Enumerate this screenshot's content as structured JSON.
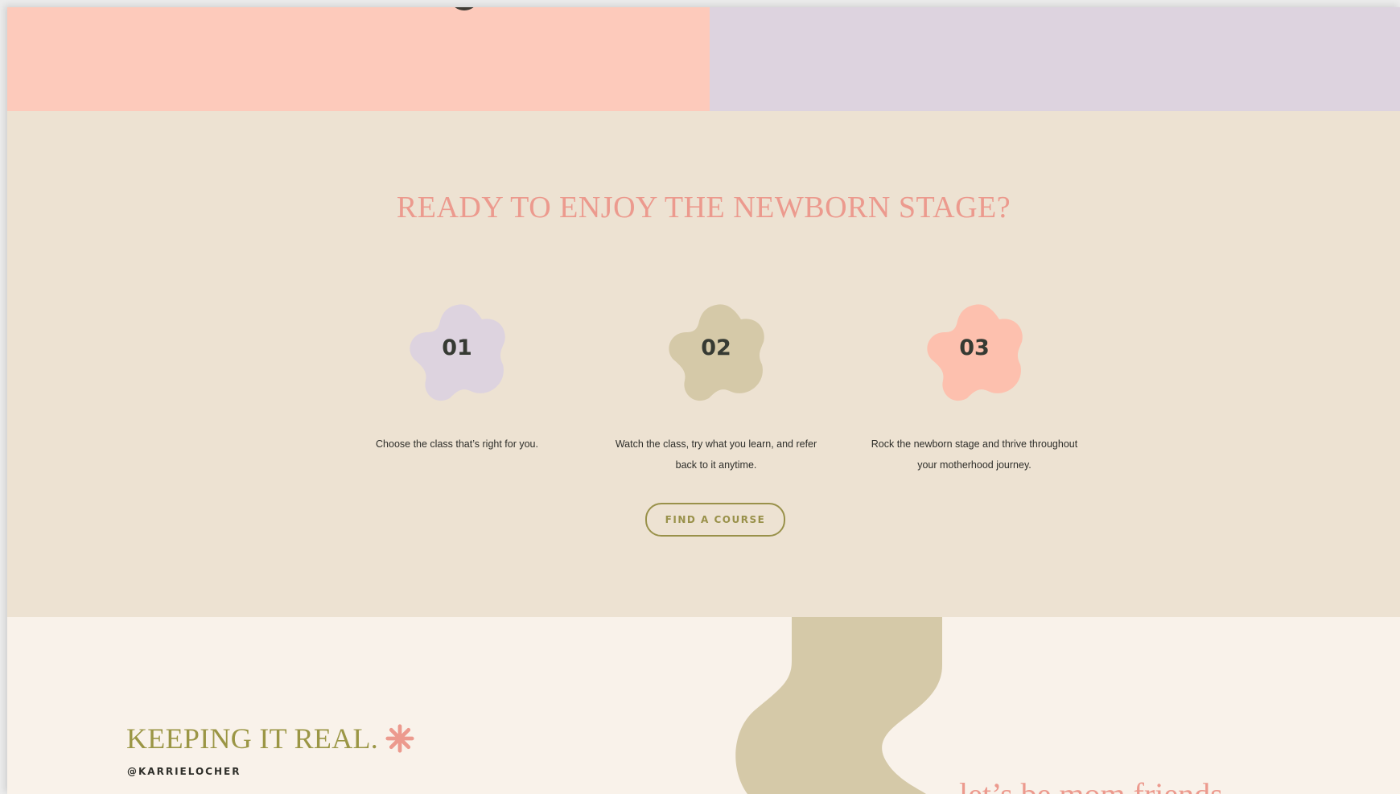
{
  "colors": {
    "peach": "#fdcabb",
    "lavender": "#ddd3df",
    "sand": "#ede2d2",
    "cream": "#f9f2ea",
    "olive": "#99914a",
    "khaki": "#d5c9a8",
    "coral_text": "#ec9a8e",
    "dark_text": "#363a33"
  },
  "steps_section": {
    "headline": "READY TO ENJOY THE NEWBORN STAGE?",
    "steps": [
      {
        "number": "01",
        "text": "Choose the class that’s right for you.",
        "blob_color": "#ddd3df"
      },
      {
        "number": "02",
        "text": "Watch the class, try what you learn, and refer back to it anytime.",
        "blob_color": "#d5c9a8"
      },
      {
        "number": "03",
        "text": "Rock the newborn stage and thrive throughout your motherhood journey.",
        "blob_color": "#fdc0ae"
      }
    ],
    "cta_label": "FIND A COURSE"
  },
  "bottom_section": {
    "title": "KEEPING IT REAL.",
    "asterisk_icon": "asterisk-icon",
    "handle": "@KARRIELOCHER",
    "tagline": "let’s be mom friends"
  }
}
